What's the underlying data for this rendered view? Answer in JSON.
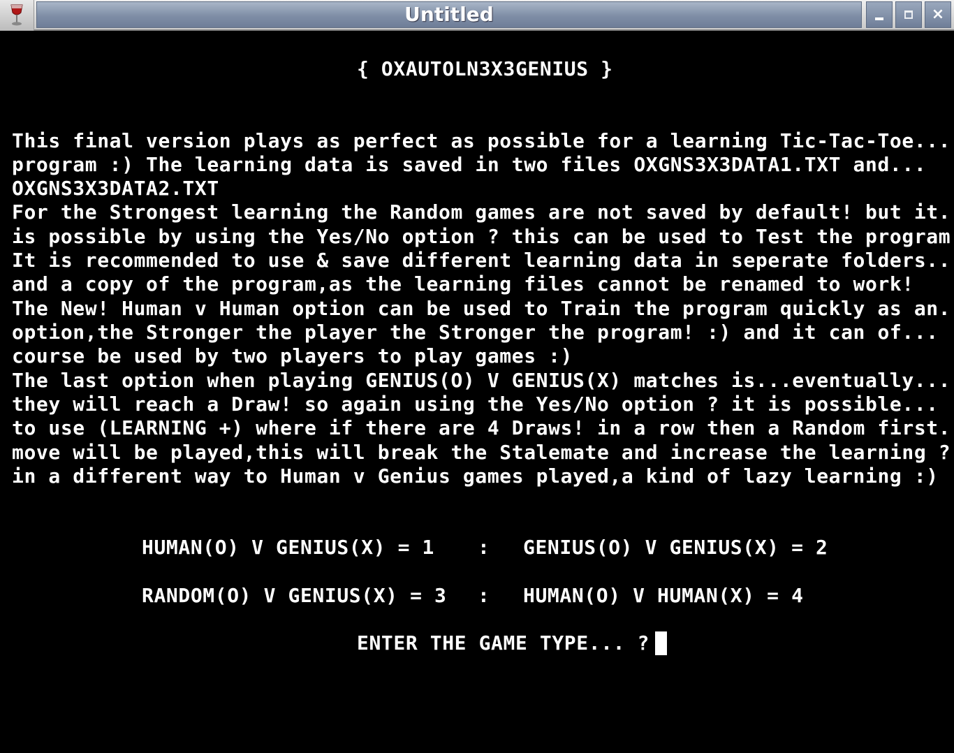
{
  "window": {
    "title": "Untitled",
    "icon": "wine-glass-icon",
    "controls": [
      "minimize-icon",
      "maximize-icon",
      "close-icon"
    ],
    "close_glyph": "×"
  },
  "console": {
    "heading": "{ OXAUTOLN3X3GENIUS }",
    "paragraph": [
      "This final version plays as perfect as possible for a learning Tic-Tac-Toe...",
      "program :) The learning data is saved in two files OXGNS3X3DATA1.TXT and...",
      "OXGNS3X3DATA2.TXT",
      "For the Strongest learning the Random games are not saved by default! but it...",
      "is possible by using the Yes/No option ? this can be used to Test the program.",
      "It is recommended to use & save different learning data in seperate folders...",
      "and a copy of the program,as the learning files cannot be renamed to work!",
      "The New! Human v Human option can be used to Train the program quickly as an...",
      "option,the Stronger the player the Stronger the program! :) and it can of...",
      "course be used by two players to play games :)",
      "The last option when playing GENIUS(O) V GENIUS(X) matches is...eventually...",
      "they will reach a Draw! so again using the Yes/No option ? it is possible...",
      "to use (LEARNING +) where if there are 4 Draws! in a row then a Random first...",
      "move will be played,this will break the Stalemate and increase the learning ?..",
      "in a different way to Human v Genius games played,a kind of lazy learning :)"
    ],
    "menu": {
      "separator": ":",
      "option1": "HUMAN(O) V GENIUS(X) = 1",
      "option2": "GENIUS(O) V GENIUS(X) = 2",
      "option3": "RANDOM(O) V GENIUS(X) = 3",
      "option4": "HUMAN(O) V HUMAN(X) = 4"
    },
    "prompt": "ENTER THE GAME TYPE... ?"
  }
}
